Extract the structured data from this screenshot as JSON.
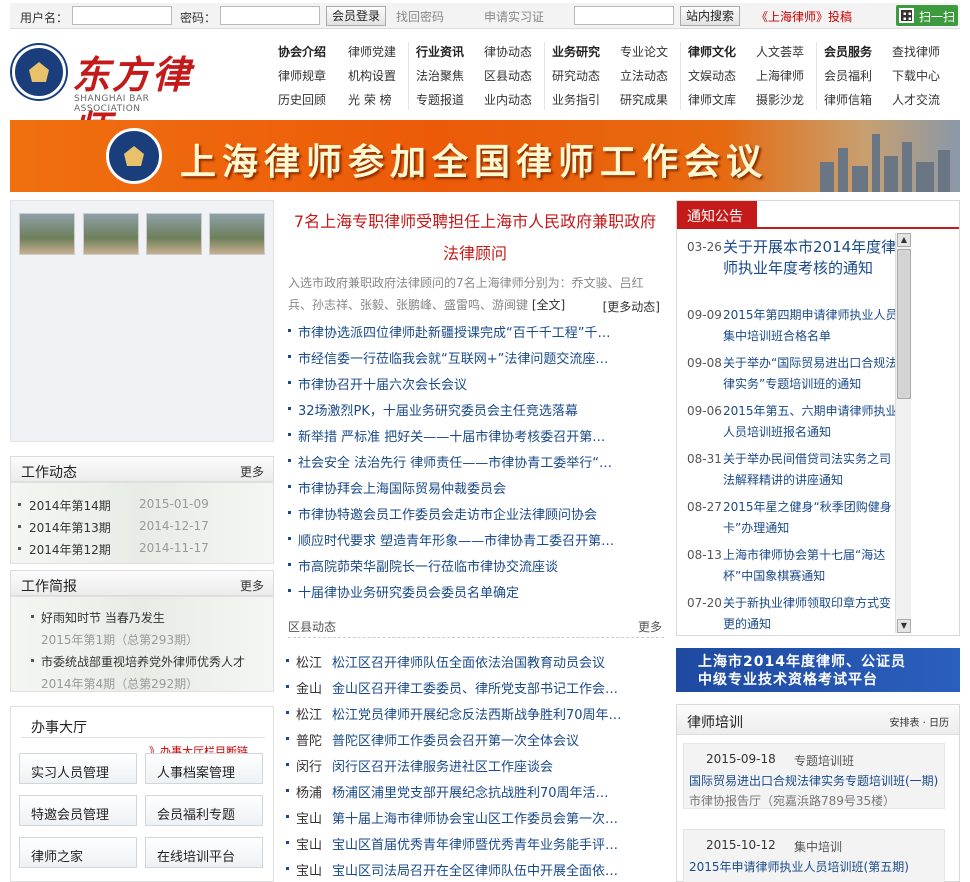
{
  "login": {
    "username_label": "用户名：",
    "password_label": "密码：",
    "login_button": "会员登录",
    "forgot_password": "找回密码",
    "apply_certificate": "申请实习证",
    "search_button": "站内搜索",
    "submit_link": "《上海律师》投稿",
    "scan_label": "扫一扫"
  },
  "logo": {
    "chinese": "东方律师",
    "english": "SHANGHAI BAR ASSOCIATION"
  },
  "nav": [
    {
      "items": [
        "协会介绍",
        "律师党建",
        "律师规章",
        "机构设置",
        "历史回顾",
        "光 荣 榜"
      ]
    },
    {
      "items": [
        "行业资讯",
        "律协动态",
        "法治聚焦",
        "区县动态",
        "专题报道",
        "业内动态"
      ]
    },
    {
      "items": [
        "业务研究",
        "专业论文",
        "研究动态",
        "立法动态",
        "业务指引",
        "研究成果"
      ]
    },
    {
      "items": [
        "律师文化",
        "人文荟萃",
        "文娱动态",
        "上海律师",
        "律师文库",
        "摄影沙龙"
      ]
    },
    {
      "items": [
        "会员服务",
        "查找律师",
        "会员福利",
        "下载中心",
        "律师信箱",
        "人才交流"
      ]
    }
  ],
  "banner": {
    "text": "上海律师参加全国律师工作会议"
  },
  "work_news": {
    "title": "工作动态",
    "more": "更多",
    "items": [
      {
        "label": "2014年第14期",
        "date": "2015-01-09"
      },
      {
        "label": "2014年第13期",
        "date": "2014-12-17"
      },
      {
        "label": "2014年第12期",
        "date": "2014-11-17"
      }
    ]
  },
  "work_brief": {
    "title": "工作简报",
    "more": "更多",
    "items": [
      {
        "label": "好雨知时节 当春乃发生",
        "sub": "2015年第1期（总第293期）"
      },
      {
        "label": "市委统战部重视培养党外律师优秀人才",
        "sub": "2014年第4期（总第292期）"
      }
    ]
  },
  "service_hall": {
    "title": "办事大厅",
    "notice": "》办事大厅栏目断链",
    "buttons": [
      "实习人员管理",
      "人事档案管理",
      "特邀会员管理",
      "会员福利专题",
      "律师之家",
      "在线培训平台"
    ]
  },
  "headline": {
    "title": "7名上海专职律师受聘担任上海市人民政府兼职政府法律顾问",
    "summary": "入选市政府兼职政府法律顾问的7名上海律师分别为：乔文骏、吕红兵、孙志祥、张毅、张鹏峰、盛雷鸣、游闽键",
    "full_text": "[全文]",
    "more": "[更多动态]"
  },
  "news": [
    "市律协选派四位律师赴新疆授课完成“百千千工程”千…",
    "市经信委一行莅临我会就“互联网+”法律问题交流座…",
    "市律协召开十届六次会长会议",
    "32场激烈PK，十届业务研究委员会主任竞选落幕",
    "新举措 严标准 把好关——十届市律协考核委召开第…",
    "社会安全 法治先行 律师责任——市律协青工委举行“…",
    "市律协拜会上海国际贸易仲裁委员会",
    "市律协特邀会员工作委员会走访市企业法律顾问协会",
    "顺应时代要求 塑造青年形象——市律协青工委召开第…",
    "市高院茆荣华副院长一行莅临市律协交流座谈",
    "十届律协业务研究委员会委员名单确定"
  ],
  "district": {
    "title": "区县动态",
    "more": "更多",
    "items": [
      {
        "district": "松江",
        "text": "松江区召开律师队伍全面依法治国教育动员会议"
      },
      {
        "district": "金山",
        "text": "金山区召开律工委委员、律所党支部书记工作会…"
      },
      {
        "district": "松江",
        "text": "松江党员律师开展纪念反法西斯战争胜利70周年…"
      },
      {
        "district": "普陀",
        "text": "普陀区律师工作委员会召开第一次全体会议"
      },
      {
        "district": "闵行",
        "text": "闵行区召开法律服务进社区工作座谈会"
      },
      {
        "district": "杨浦",
        "text": "杨浦区浦里党支部开展纪念抗战胜利70周年活…"
      },
      {
        "district": "宝山",
        "text": "第十届上海市律师协会宝山区工作委员会第一次…"
      },
      {
        "district": "宝山",
        "text": "宝山区首届优秀青年律师暨优秀青年业务能手评…"
      },
      {
        "district": "宝山",
        "text": "宝山区司法局召开在全区律师队伍中开展全面依…"
      }
    ]
  },
  "notice": {
    "title": "通知公告",
    "items": [
      {
        "date": "03-26",
        "text": "关于开展本市2014年度律师执业年度考核的通知"
      },
      {
        "date": "09-09",
        "text": "2015年第四期申请律师执业人员集中培训班合格名单"
      },
      {
        "date": "09-08",
        "text": "关于举办“国际贸易进出口合规法律实务”专题培训班的通知"
      },
      {
        "date": "09-06",
        "text": "2015年第五、六期申请律师执业人员培训班报名通知"
      },
      {
        "date": "08-31",
        "text": "关于举办民间借贷司法实务之司法解释精讲的讲座通知"
      },
      {
        "date": "08-27",
        "text": "2015年星之健身“秋季团购健身卡”办理通知"
      },
      {
        "date": "08-13",
        "text": "上海市律师协会第十七届“海达杯”中国象棋赛通知"
      },
      {
        "date": "07-20",
        "text": "关于新执业律师领取印章方式变更的通知"
      }
    ]
  },
  "exam_banner": {
    "line1": "上海市2014年度律师、公证员",
    "line2": "中级专业技术资格考试平台"
  },
  "training": {
    "title": "律师培训",
    "links": "安排表 · 日历",
    "items": [
      {
        "date": "2015-09-18",
        "type": "专题培训班",
        "title": "国际贸易进出口合规法律实务专题培训班(一期)",
        "place": "市律协报告厅（宛嘉浜路789号35楼）"
      },
      {
        "date": "2015-10-12",
        "type": "集中培训",
        "title": "2015年申请律师执业人员培训班(第五期)",
        "place": ""
      }
    ]
  }
}
